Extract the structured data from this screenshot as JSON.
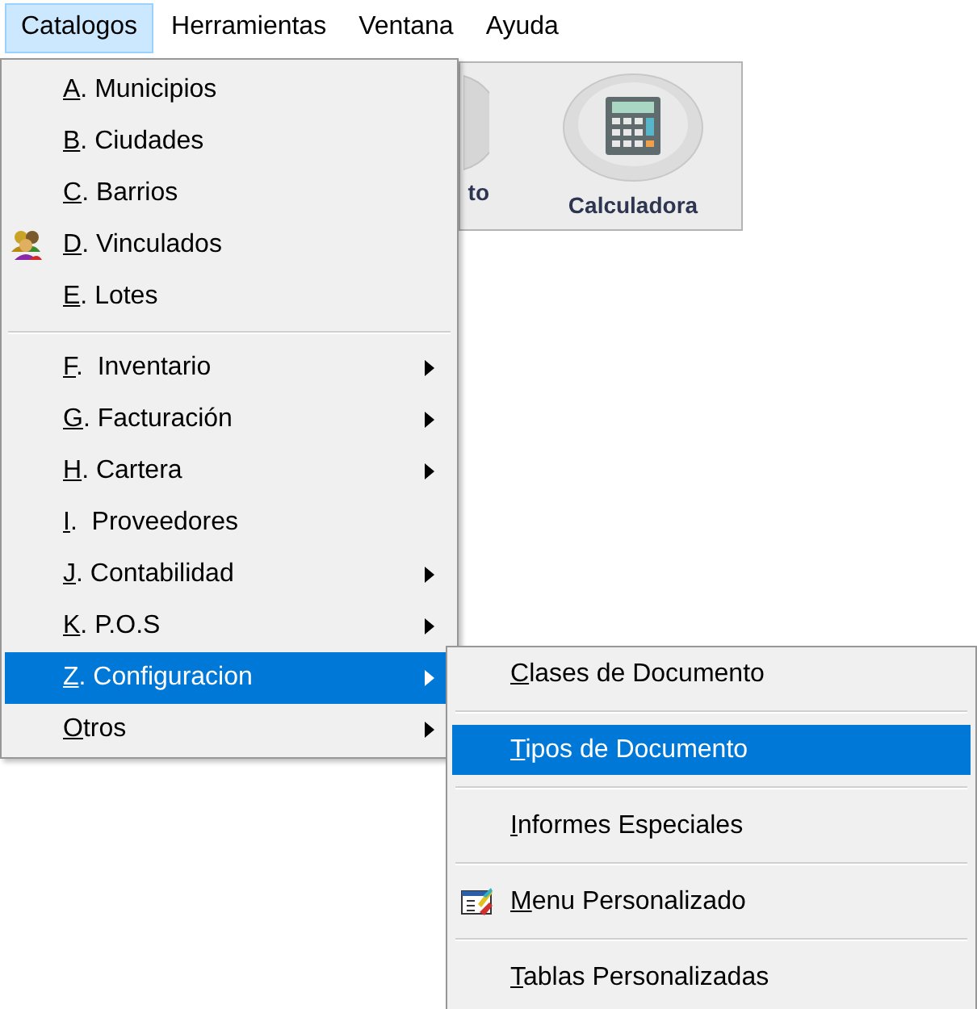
{
  "menubar": [
    {
      "label": "Catalogos",
      "selected": true
    },
    {
      "label": "Herramientas",
      "selected": false
    },
    {
      "label": "Ventana",
      "selected": false
    },
    {
      "label": "Ayuda",
      "selected": false
    }
  ],
  "toolbar": {
    "buttons": [
      {
        "kind": "partial",
        "label": "to"
      },
      {
        "kind": "calculator",
        "label": "Calculadora"
      }
    ]
  },
  "menu": {
    "items": [
      {
        "kind": "item",
        "label": "A. Municipios",
        "selected": false,
        "submenu": false
      },
      {
        "kind": "item",
        "label": "B. Ciudades",
        "selected": false,
        "submenu": false
      },
      {
        "kind": "item",
        "label": "C. Barrios",
        "selected": false,
        "submenu": false
      },
      {
        "kind": "icon_item",
        "label": "D. Vinculados",
        "selected": false,
        "submenu": false
      },
      {
        "kind": "item",
        "label": "E. Lotes",
        "selected": false,
        "submenu": false
      },
      {
        "kind": "separator"
      },
      {
        "kind": "item",
        "label": "F.  Inventario",
        "selected": false,
        "submenu": true
      },
      {
        "kind": "item",
        "label": "G. Facturación",
        "selected": false,
        "submenu": true
      },
      {
        "kind": "item",
        "label": "H. Cartera",
        "selected": false,
        "submenu": true
      },
      {
        "kind": "item",
        "label": "I.  Proveedores",
        "selected": false,
        "submenu": false
      },
      {
        "kind": "item",
        "label": "J. Contabilidad",
        "selected": false,
        "submenu": true
      },
      {
        "kind": "item",
        "label": "K. P.O.S",
        "selected": false,
        "submenu": true
      },
      {
        "kind": "item",
        "label": "Z. Configuracion",
        "selected": true,
        "submenu": true
      },
      {
        "kind": "item",
        "label": "Otros",
        "selected": false,
        "submenu": true
      }
    ]
  },
  "submenu": {
    "items": [
      {
        "kind": "item",
        "label": "Clases de Documento",
        "selected": false
      },
      {
        "kind": "separator"
      },
      {
        "kind": "item",
        "label": "Tipos de Documento",
        "selected": true
      },
      {
        "kind": "separator"
      },
      {
        "kind": "item",
        "label": "Informes Especiales",
        "selected": false
      },
      {
        "kind": "separator"
      },
      {
        "kind": "icon_item",
        "label": "Menu Personalizado",
        "selected": false
      },
      {
        "kind": "separator"
      },
      {
        "kind": "item",
        "label": "Tablas Personalizadas",
        "selected": false
      }
    ]
  }
}
